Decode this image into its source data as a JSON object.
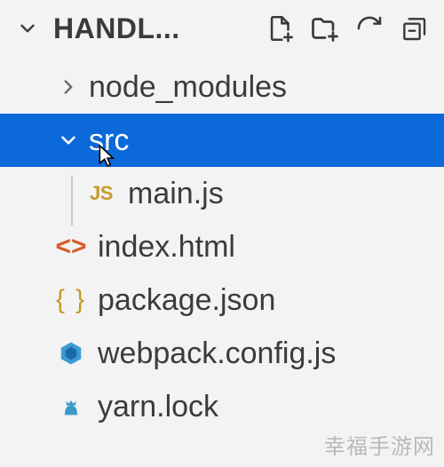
{
  "header": {
    "title": "HANDL..."
  },
  "actions": {
    "new_file": "New File",
    "new_folder": "New Folder",
    "refresh": "Refresh",
    "collapse_all": "Collapse All"
  },
  "tree": {
    "node_modules": {
      "label": "node_modules",
      "expanded": false
    },
    "src": {
      "label": "src",
      "expanded": true,
      "selected": true,
      "children": {
        "main_js": {
          "label": "main.js",
          "icon": "JS"
        }
      }
    },
    "index_html": {
      "label": "index.html"
    },
    "package_json": {
      "label": "package.json"
    },
    "webpack_config_js": {
      "label": "webpack.config.js"
    },
    "yarn_lock": {
      "label": "yarn.lock"
    }
  },
  "watermark": "幸福手游网"
}
